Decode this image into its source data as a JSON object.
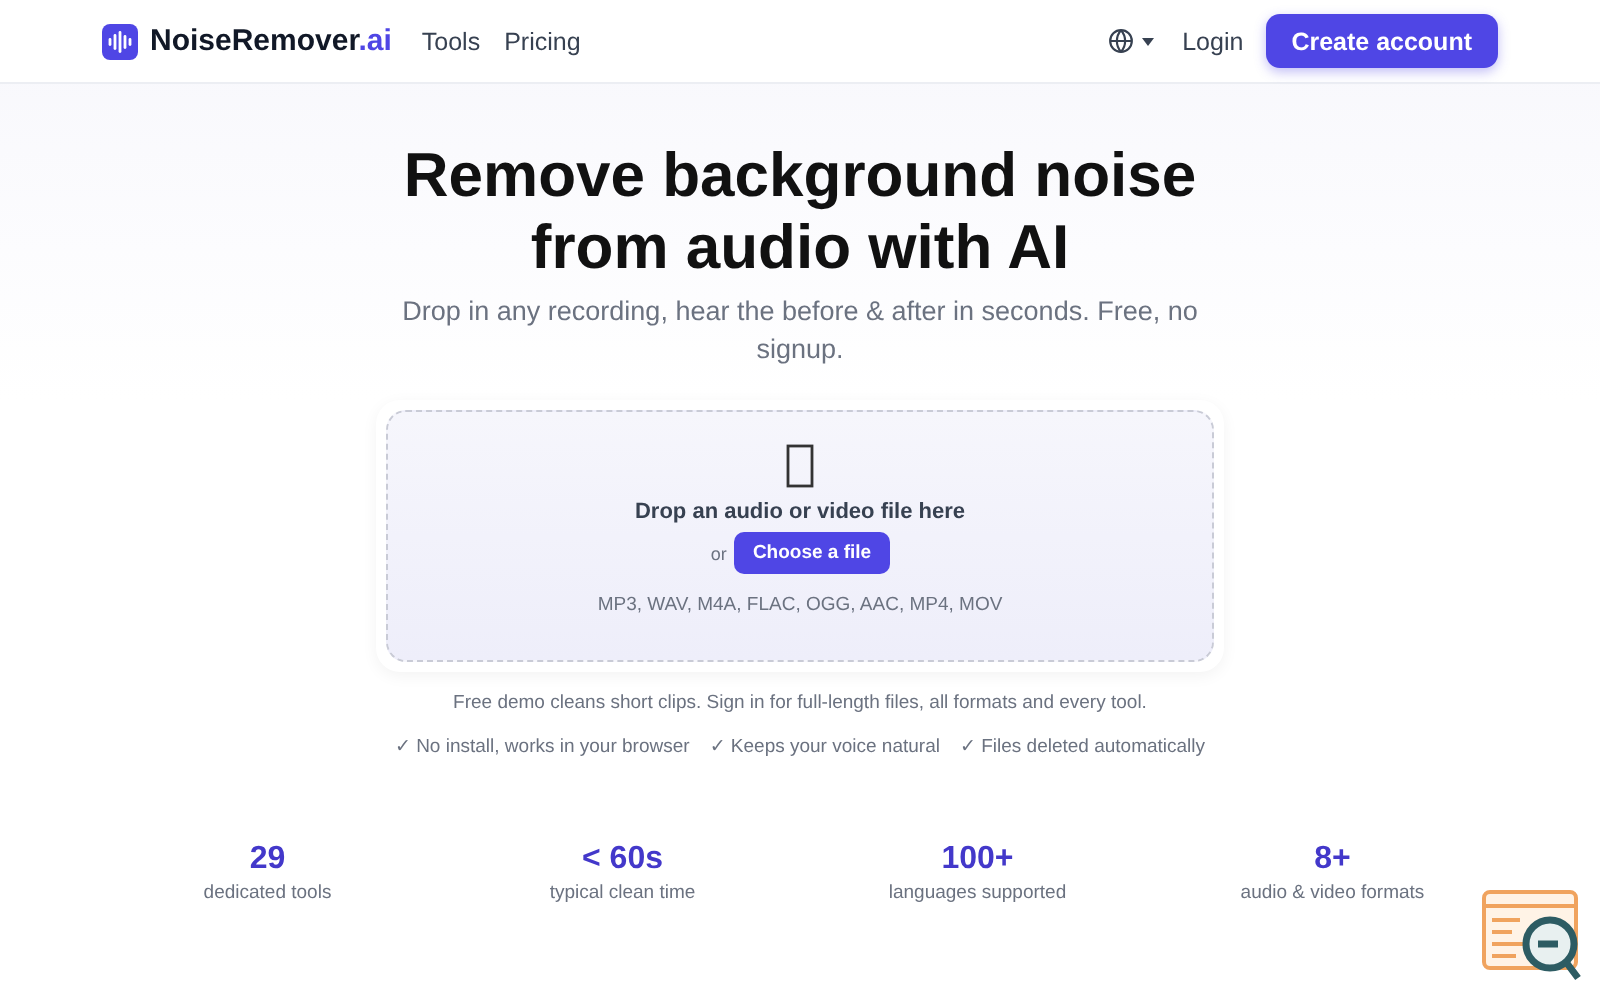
{
  "header": {
    "logo": {
      "name": "NoiseRemover",
      "suffix": ".ai"
    },
    "nav": [
      "Tools",
      "Pricing"
    ],
    "login": "Login",
    "cta": "Create account"
  },
  "hero": {
    "title": "Remove background noise from audio with AI",
    "subtitle": "Drop in any recording, hear the before & after in seconds. Free, no signup."
  },
  "dropzone": {
    "heading": "Drop an audio or video file here",
    "or": "or",
    "button": "Choose a file",
    "formats": "MP3, WAV, M4A, FLAC, OGG, AAC, MP4, MOV"
  },
  "note": "Free demo cleans short clips. Sign in for full-length files, all formats and every tool.",
  "features": [
    "✓ No install, works in your browser",
    "✓ Keeps your voice natural",
    "✓ Files deleted automatically"
  ],
  "stats": [
    {
      "value": "29",
      "label": "dedicated tools"
    },
    {
      "value": "< 60s",
      "label": "typical clean time"
    },
    {
      "value": "100+",
      "label": "languages supported"
    },
    {
      "value": "8+",
      "label": "audio & video formats"
    }
  ]
}
